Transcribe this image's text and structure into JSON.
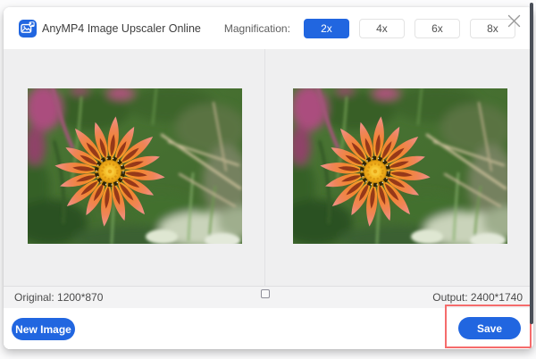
{
  "colors": {
    "accent": "#2166e0",
    "save_highlight": "#f56c6c"
  },
  "header": {
    "title": "AnyMP4 Image Upscaler Online",
    "magnification_label": "Magnification:",
    "options": [
      {
        "label": "2x",
        "selected": true
      },
      {
        "label": "4x",
        "selected": false
      },
      {
        "label": "6x",
        "selected": false
      },
      {
        "label": "8x",
        "selected": false
      }
    ],
    "logo_icon": "image-upscaler-logo-icon",
    "close_icon": "close-icon"
  },
  "preview": {
    "left_image": "original flower photo preview",
    "right_image": "upscaled flower photo preview"
  },
  "statusbar": {
    "original_label": "Original: 1200*870",
    "output_label": "Output: 2400*1740",
    "compare_icon": "compare-toggle-icon"
  },
  "footer": {
    "new_image_label": "New Image",
    "save_label": "Save"
  }
}
